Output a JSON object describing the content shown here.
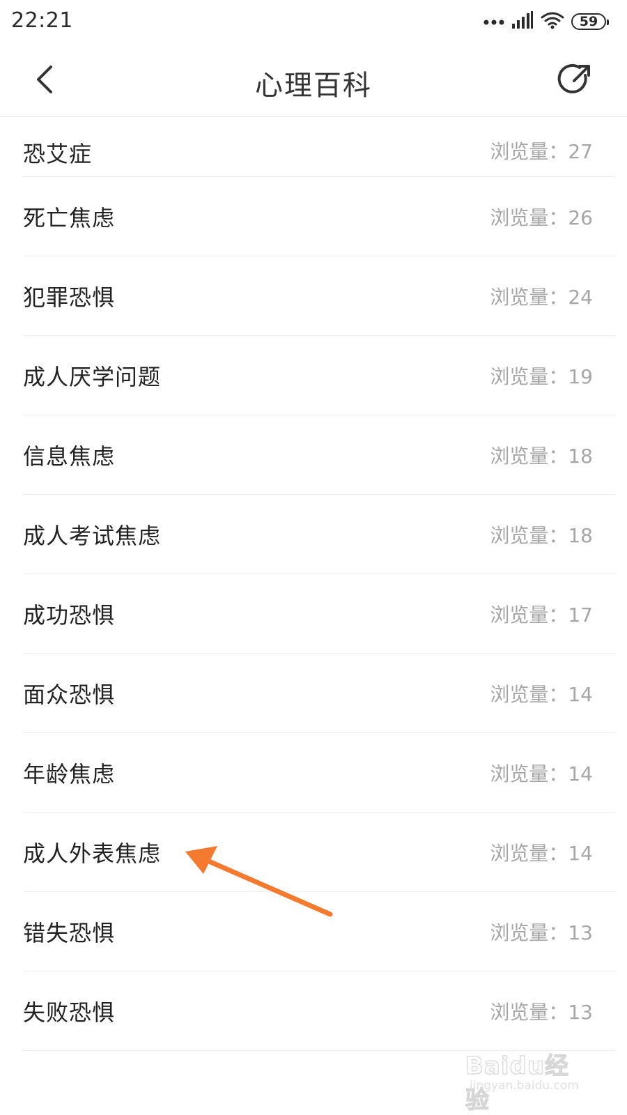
{
  "status_bar": {
    "time": "22:21",
    "battery": "59",
    "icons": [
      "more-dots-icon",
      "signal-icon",
      "wifi-icon",
      "battery-icon"
    ]
  },
  "nav": {
    "title": "心理百科",
    "back_icon": "chevron-left-icon",
    "share_icon": "share-icon"
  },
  "list": {
    "items": [
      {
        "title": "恐艾症",
        "views": "浏览量：27"
      },
      {
        "title": "死亡焦虑",
        "views": "浏览量：26"
      },
      {
        "title": "犯罪恐惧",
        "views": "浏览量：24"
      },
      {
        "title": "成人厌学问题",
        "views": "浏览量：19"
      },
      {
        "title": "信息焦虑",
        "views": "浏览量：18"
      },
      {
        "title": "成人考试焦虑",
        "views": "浏览量：18"
      },
      {
        "title": "成功恐惧",
        "views": "浏览量：17"
      },
      {
        "title": "面众恐惧",
        "views": "浏览量：14"
      },
      {
        "title": "年龄焦虑",
        "views": "浏览量：14"
      },
      {
        "title": "成人外表焦虑",
        "views": "浏览量：14"
      },
      {
        "title": "错失恐惧",
        "views": "浏览量：13"
      },
      {
        "title": "失败恐惧",
        "views": "浏览量：13"
      }
    ]
  },
  "annotation": {
    "color": "#f47a2f"
  },
  "watermark": {
    "logo": "Baidu经验",
    "url": "jingyan.baidu.com"
  }
}
